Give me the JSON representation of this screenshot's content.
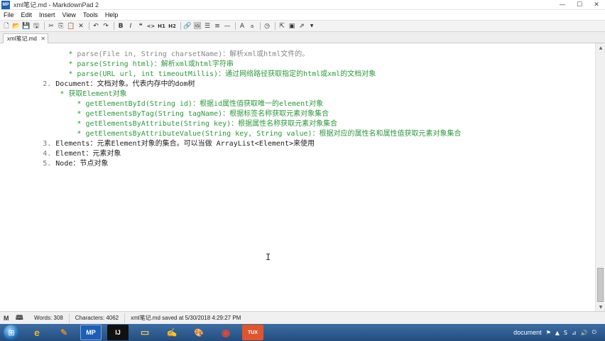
{
  "window": {
    "title": "xml笔记.md - MarkdownPad 2",
    "app_icon_label": "MP",
    "minimize_glyph": "—",
    "maximize_glyph": "☐",
    "close_glyph": "✕"
  },
  "menu": {
    "items": [
      "File",
      "Edit",
      "Insert",
      "View",
      "Tools",
      "Help"
    ]
  },
  "toolbar": {
    "heading1_label": "H1",
    "heading2_label": "H2",
    "code_label": "<>"
  },
  "tab": {
    "label": "xml笔记.md",
    "close_glyph": "✕"
  },
  "editor": {
    "lines": [
      {
        "indent": "            ",
        "marker": "* ",
        "code": "parse(File in, String charsetName)",
        "desc": "：解析xml或html文件的。",
        "style": "green-partial"
      },
      {
        "indent": "            ",
        "marker": "* ",
        "code": "parse(String html)",
        "desc": "：解析xml或html字符串",
        "style": "green"
      },
      {
        "indent": "            ",
        "marker": "* ",
        "code": "parse(URL url, int timeoutMillis)",
        "desc": "：通过网络路径获取指定的html或xml的文档对象",
        "style": "green"
      },
      {
        "indent": "      ",
        "marker": "2. ",
        "code": "Document",
        "desc": "：文档对象。代表内存中的dom树",
        "style": "dark"
      },
      {
        "indent": "          ",
        "marker": "* ",
        "code": "获取Element对象",
        "desc": "",
        "style": "green"
      },
      {
        "indent": "              ",
        "marker": "* ",
        "code": "getElementById(String id)",
        "desc": "：根据id属性值获取唯一的element对象",
        "style": "green"
      },
      {
        "indent": "              ",
        "marker": "* ",
        "code": "getElementsByTag(String tagName)",
        "desc": "：根据标签名称获取元素对象集合",
        "style": "green"
      },
      {
        "indent": "              ",
        "marker": "* ",
        "code": "getElementsByAttribute(String key)",
        "desc": "：根据属性名称获取元素对象集合",
        "style": "green"
      },
      {
        "indent": "              ",
        "marker": "* ",
        "code": "getElementsByAttributeValue(String key, String value)",
        "desc": "：根据对应的属性名和属性值获取元素对象集合",
        "style": "green"
      },
      {
        "indent": "      ",
        "marker": "3. ",
        "code": "Elements",
        "desc": "：元素Element对象的集合。可以当做 ArrayList<Element>来使用",
        "style": "dark"
      },
      {
        "indent": "      ",
        "marker": "4. ",
        "code": "Element",
        "desc": "：元素对象",
        "style": "dark"
      },
      {
        "indent": "      ",
        "marker": "5. ",
        "code": "Node",
        "desc": "：节点对象",
        "style": "dark"
      }
    ],
    "cursor_glyph": "I"
  },
  "status": {
    "words": "Words: 308",
    "characters": "Characters: 4062",
    "saved": "xml笔记.md saved at 5/30/2018 4:29:27 PM",
    "mode_glyph": "M"
  },
  "taskbar": {
    "apps": [
      {
        "name": "ie-taskbar-app",
        "label": "e",
        "color": "#f3b233"
      },
      {
        "name": "paint-taskbar-app",
        "label": "✎",
        "color": "#d88a2e"
      },
      {
        "name": "markdownpad-taskbar-app",
        "label": "MP",
        "color": "#1d5fb4"
      },
      {
        "name": "intellij-taskbar-app",
        "label": "IJ",
        "color": "#111111"
      },
      {
        "name": "explorer-taskbar-app",
        "label": "▭",
        "color": "#e9c44c"
      },
      {
        "name": "notepad-taskbar-app",
        "label": "✍",
        "color": "#7fb24a"
      },
      {
        "name": "paint2-taskbar-app",
        "label": "🎨",
        "color": "#bfae7a"
      },
      {
        "name": "chrome-taskbar-app",
        "label": "◉",
        "color": "#d9493a"
      },
      {
        "name": "tux-taskbar-app",
        "label": "TUX",
        "color": "#e0552b"
      }
    ],
    "tray_text": "document",
    "colors": {
      "taskbar_top": "#3b6ea5",
      "taskbar_bottom": "#244d7d"
    }
  },
  "colors": {
    "green_text": "#2b9a3a",
    "dark_text": "#222222",
    "line_number": "#777777"
  }
}
